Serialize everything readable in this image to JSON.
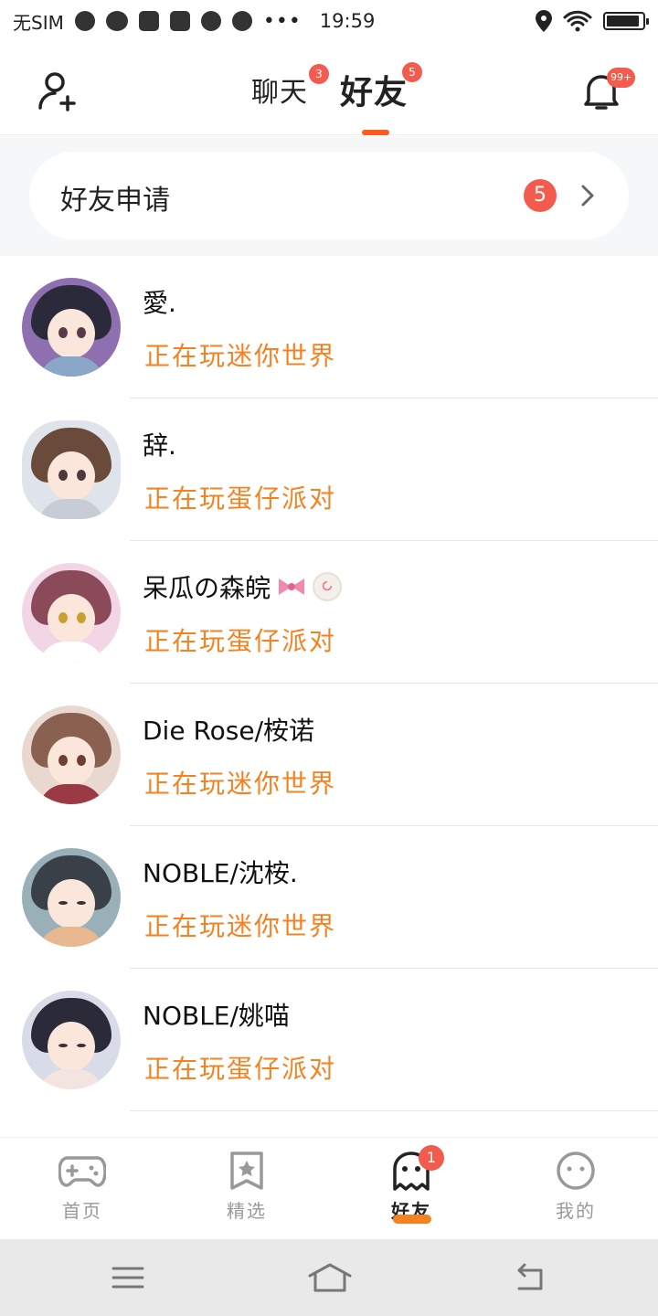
{
  "status_bar": {
    "carrier": "无SIM",
    "time": "19:59"
  },
  "header": {
    "tabs": [
      {
        "label": "聊天",
        "badge": "3"
      },
      {
        "label": "好友",
        "badge": "5"
      }
    ],
    "notification_badge": "99+"
  },
  "friend_request": {
    "label": "好友申请",
    "count": "5"
  },
  "friends": [
    {
      "name": "愛.",
      "status": "正在玩迷你世界"
    },
    {
      "name": "辞.",
      "status": "正在玩蛋仔派对"
    },
    {
      "name": "呆瓜の森皖",
      "status": "正在玩蛋仔派对"
    },
    {
      "name": "Die Rose/桉诺",
      "status": "正在玩迷你世界"
    },
    {
      "name": "NOBLE/沈桉.",
      "status": "正在玩迷你世界"
    },
    {
      "name": "NOBLE/姚喵",
      "status": "正在玩蛋仔派对"
    }
  ],
  "bottom_nav": {
    "items": [
      {
        "label": "首页",
        "icon": "gamepad-icon"
      },
      {
        "label": "精选",
        "icon": "star-badge-icon"
      },
      {
        "label": "好友",
        "icon": "ghost-icon",
        "badge": "1"
      },
      {
        "label": "我的",
        "icon": "face-icon"
      }
    ],
    "active": "好友"
  },
  "colors": {
    "accent": "#ff5a1f",
    "status_text": "#f58220",
    "badge": "#f25b4d"
  }
}
